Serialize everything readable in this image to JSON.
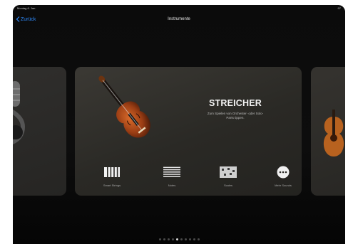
{
  "status": {
    "time_date": "Montag 6. Jan.",
    "battery": "97"
  },
  "nav": {
    "back_label": "Zurück",
    "title": "Instrumente"
  },
  "instrument": {
    "name": "STREICHER",
    "description_line1": "Zum Spielen von Orchester- oder Solo-",
    "description_line2": "Parts tippen."
  },
  "modes": [
    {
      "label": "Smart Strings",
      "icon": "piano-keys-icon"
    },
    {
      "label": "Notes",
      "icon": "lines-icon"
    },
    {
      "label": "Scales",
      "icon": "scale-grid-icon"
    },
    {
      "label": "Mehr Sounds",
      "icon": "more-icon"
    }
  ],
  "pages": {
    "count": 10,
    "active_index": 4
  },
  "colors": {
    "accent": "#2f8cff",
    "background": "#0b0b0b",
    "card": "#2f2d29"
  }
}
